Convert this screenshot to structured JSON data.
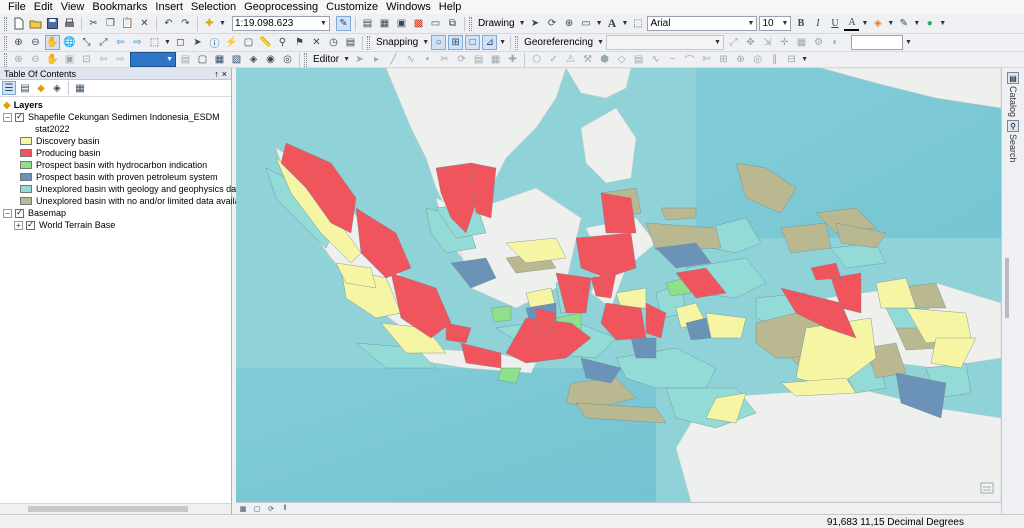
{
  "menu": [
    "File",
    "Edit",
    "View",
    "Bookmarks",
    "Insert",
    "Selection",
    "Geoprocessing",
    "Customize",
    "Windows",
    "Help"
  ],
  "toolbar": {
    "scale": "1:19.098.623",
    "drawing_label": "Drawing",
    "text_tool": "A",
    "font_name": "Arial",
    "font_size": "10",
    "bold": "B",
    "italic": "I",
    "underline": "U",
    "font_color": "A",
    "snapping_label": "Snapping",
    "georeferencing_label": "Georeferencing",
    "editor_label": "Editor"
  },
  "toc": {
    "title": "Table Of Contents",
    "pin": "↑",
    "close": "×",
    "root_label": "Layers",
    "layer1_label": "Shapefile Cekungan Sedimen Indonesia_ESDM",
    "field_label": "stat2022",
    "legend": [
      {
        "label": "Discovery basin",
        "color": "#f5f5a3"
      },
      {
        "label": "Producing basin",
        "color": "#f0555e"
      },
      {
        "label": "Prospect basin with hydrocarbon indication",
        "color": "#8fe08a"
      },
      {
        "label": "Prospect basin with proven petroleum system",
        "color": "#6b93b8"
      },
      {
        "label": "Unexplored basin with geology and geophysics data",
        "color": "#93dbd6"
      },
      {
        "label": "Unexplored basin with no and/or limited data available",
        "color": "#b9b891"
      }
    ],
    "basemap_label": "Basemap",
    "terrain_label": "World Terrain Base"
  },
  "dock": {
    "catalog": "Catalog",
    "search": "Search"
  },
  "status": {
    "coords": "91,683  11,15 Decimal Degrees"
  },
  "colors": {
    "sea": "#8fd3d8",
    "land": "#eef0ee",
    "discovery": "#f5f5a3",
    "producing": "#f0555e",
    "prospect_hc": "#8fe08a",
    "prospect_proven": "#6b93b8",
    "unexplored_gg": "#93dbd6",
    "unexplored_limited": "#b9b891"
  }
}
